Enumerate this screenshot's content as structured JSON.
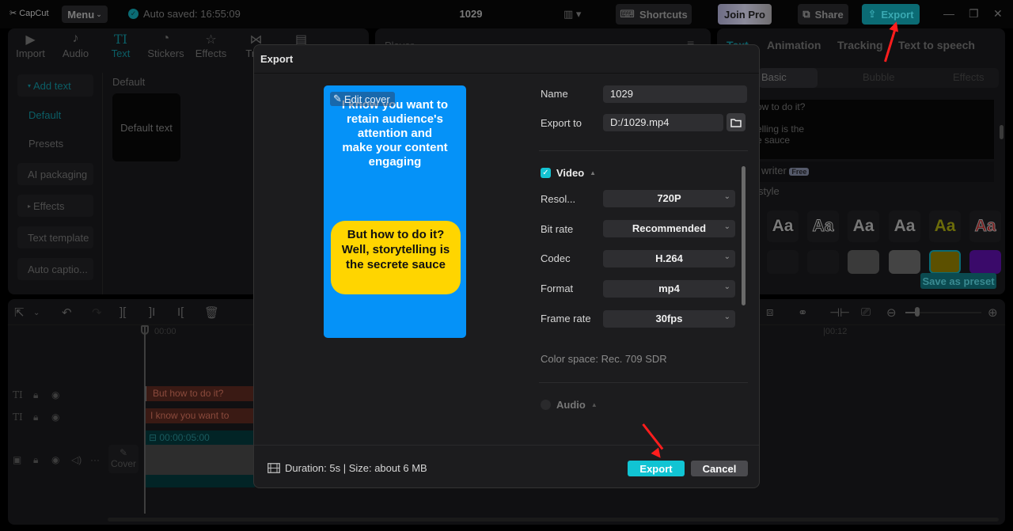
{
  "titlebar": {
    "logo": "CapCut",
    "menu_label": "Menu",
    "autosave": "Auto saved: 16:55:09",
    "project_title": "1029",
    "shortcuts_label": "Shortcuts",
    "join_pro_label": "Join Pro",
    "share_label": "Share",
    "export_label": "Export"
  },
  "media_tabs": [
    {
      "label": "Import",
      "icon": "import-icon"
    },
    {
      "label": "Audio",
      "icon": "audio-icon"
    },
    {
      "label": "Text",
      "icon": "text-icon",
      "active": true
    },
    {
      "label": "Stickers",
      "icon": "stickers-icon"
    },
    {
      "label": "Effects",
      "icon": "effects-icon"
    },
    {
      "label": "Tran",
      "icon": "transitions-icon"
    }
  ],
  "sidebar": {
    "add_text": "Add text",
    "default": "Default",
    "presets": "Presets",
    "ai_packaging": "AI packaging",
    "effects": "Effects",
    "text_template": "Text template",
    "auto_captions": "Auto captio..."
  },
  "text_panel": {
    "header": "Default",
    "card_label": "Default text"
  },
  "player": {
    "title": "Player"
  },
  "right_panel": {
    "tabs": [
      "Text",
      "Animation",
      "Tracking",
      "Text to speech"
    ],
    "subtabs": [
      "Basic",
      "Bubble",
      "Effects"
    ],
    "text_lines": [
      "ow to do it?",
      "",
      "elling is the",
      "e sauce"
    ],
    "writer_label": "writer",
    "free_badge": "Free",
    "style_label": "style",
    "save_preset": "Save as preset"
  },
  "timeline": {
    "time_start": "00:00",
    "time_mid": "|00:12",
    "clips": [
      "But how to do it?",
      "I know you want to"
    ],
    "video_duration": "00:00:05:00",
    "cover_label": "Cover"
  },
  "dialog": {
    "title": "Export",
    "edit_cover": "Edit cover",
    "cover_text_top": "I know you want to retain audience's attention and make your content engaging",
    "cover_text_bubble": "But how to do it? Well, storytelling is the secrete sauce",
    "name_label": "Name",
    "name_value": "1029",
    "export_to_label": "Export to",
    "export_to_value": "D:/1029.mp4",
    "video_section": {
      "label": "Video",
      "checked": true,
      "resolution_label": "Resol...",
      "resolution_value": "720P",
      "bitrate_label": "Bit rate",
      "bitrate_value": "Recommended",
      "codec_label": "Codec",
      "codec_value": "H.264",
      "format_label": "Format",
      "format_value": "mp4",
      "framerate_label": "Frame rate",
      "framerate_value": "30fps",
      "color_space": "Color space: Rec. 709 SDR"
    },
    "audio_section": {
      "label": "Audio",
      "checked": false
    },
    "footer_info": "Duration: 5s | Size: about 6 MB",
    "export_button": "Export",
    "cancel_button": "Cancel"
  },
  "colors": {
    "accent": "#11c4d3",
    "cover_bg": "#0592f8",
    "bubble": "#ffd500",
    "annotation_arrow": "#ff1d1d"
  }
}
